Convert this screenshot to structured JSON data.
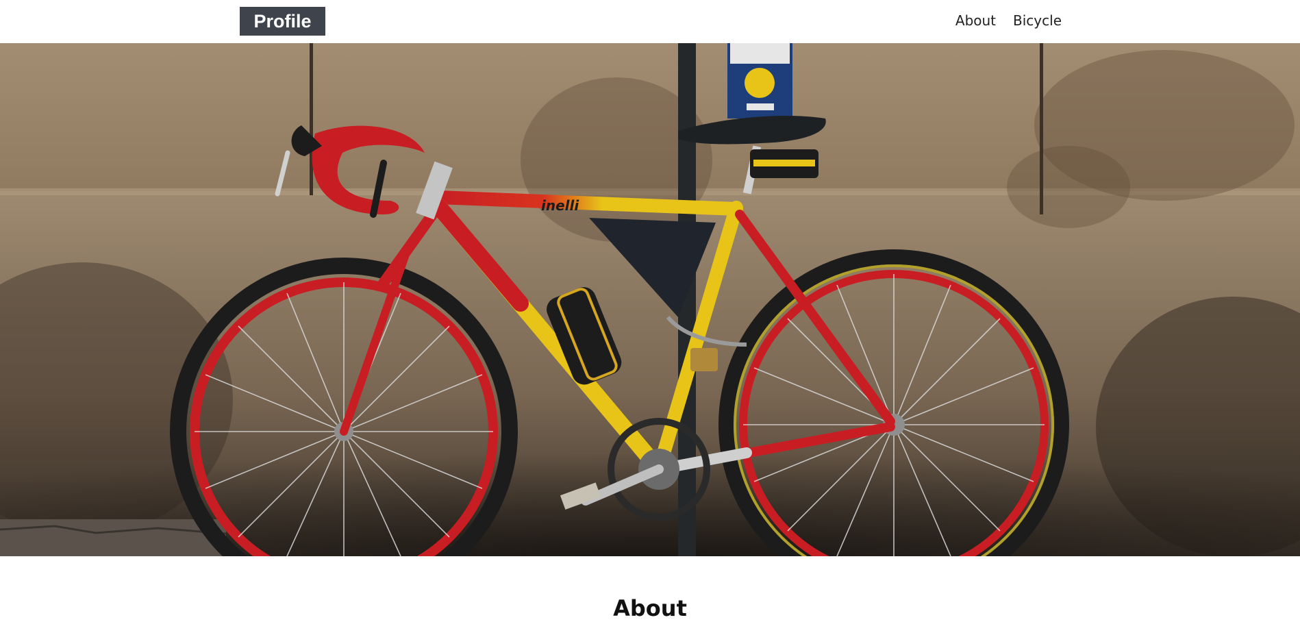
{
  "navbar": {
    "brand": "Profile",
    "links": [
      {
        "label": "About"
      },
      {
        "label": "Bicycle"
      }
    ]
  },
  "hero": {
    "image_subject": "red and yellow road bicycle leaning against a stone wall",
    "frame_brand_text": "inelli",
    "colors": {
      "wall": "#9a8469",
      "frame_red": "#c81e23",
      "frame_yellow": "#e8c318",
      "tire": "#1c1c1c"
    }
  },
  "sections": {
    "about_heading": "About"
  },
  "colors": {
    "brand_bg": "#3f444c",
    "brand_text": "#ffffff",
    "nav_text": "#222222"
  },
  "icons": {
    "brand": "profile-logo"
  }
}
